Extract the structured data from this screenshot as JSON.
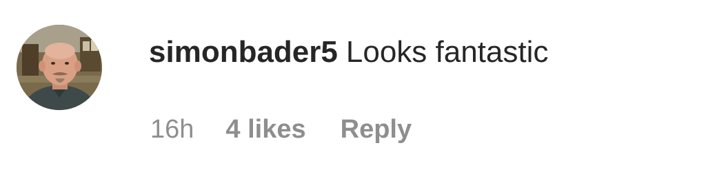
{
  "comment": {
    "avatar_icon": "user-avatar-photo",
    "username": "simonbader5",
    "text": "Looks fantastic",
    "timestamp": "16h",
    "likes": "4 likes",
    "reply_label": "Reply"
  },
  "colors": {
    "primary_text": "#262626",
    "secondary_text": "#8e8e8e",
    "background": "#ffffff"
  }
}
